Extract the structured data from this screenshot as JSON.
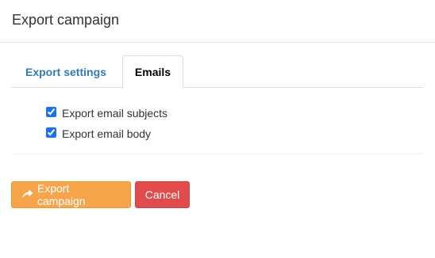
{
  "modal": {
    "title": "Export campaign"
  },
  "tabs": [
    {
      "label": "Export settings",
      "active": false
    },
    {
      "label": "Emails",
      "active": true
    }
  ],
  "options": [
    {
      "label": "Export email subjects",
      "checked": true
    },
    {
      "label": "Export email body",
      "checked": true
    }
  ],
  "footer": {
    "export_label": "Export campaign",
    "export_icon": "share-arrow-icon",
    "cancel_label": "Cancel"
  },
  "colors": {
    "export_button": "#f7a54b",
    "cancel_button": "#e24b4b",
    "tab_link": "#337ab7"
  }
}
